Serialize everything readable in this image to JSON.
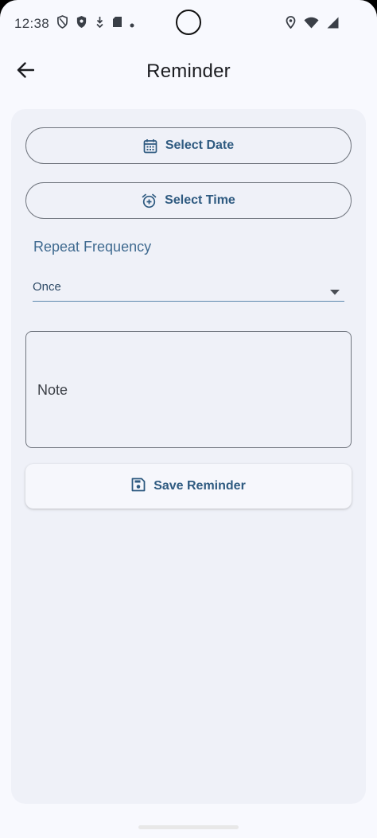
{
  "status_bar": {
    "time": "12:38"
  },
  "app_bar": {
    "title": "Reminder",
    "back_icon": "arrow-back-icon"
  },
  "form": {
    "select_date_label": "Select Date",
    "select_date_icon": "calendar-icon",
    "select_time_label": "Select Time",
    "select_time_icon": "alarm-add-icon",
    "repeat_frequency_label": "Repeat Frequency",
    "repeat_frequency_value": "Once",
    "note_label": "Note",
    "save_label": "Save Reminder",
    "save_icon": "save-icon"
  },
  "colors": {
    "accent": "#2e5a80",
    "background": "#f8f9fe",
    "card": "#eff1f8",
    "outline": "#71767f"
  }
}
